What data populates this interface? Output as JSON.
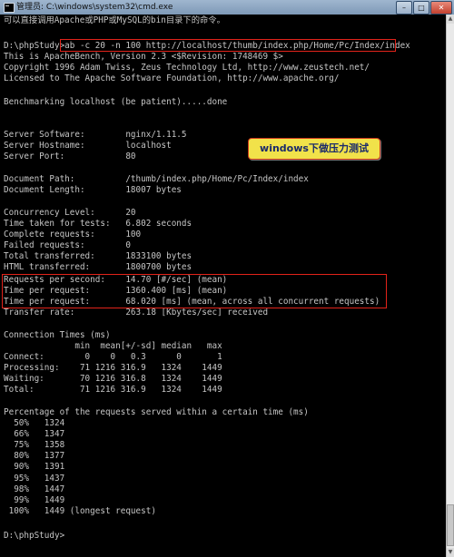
{
  "window": {
    "title": "管理员: C:\\windows\\system32\\cmd.exe",
    "buttons": {
      "minimize": "–",
      "maximize": "□",
      "close": "✕"
    }
  },
  "console": {
    "lines": [
      "可以直接调用Apache或PHP或MySQL的bin目录下的命令。",
      "",
      "D:\\phpStudy>ab -c 20 -n 100 http://localhost/thumb/index.php/Home/Pc/Index/index",
      "This is ApacheBench, Version 2.3 <$Revision: 1748469 $>",
      "Copyright 1996 Adam Twiss, Zeus Technology Ltd, http://www.zeustech.net/",
      "Licensed to The Apache Software Foundation, http://www.apache.org/",
      "",
      "Benchmarking localhost (be patient).....done",
      "",
      "",
      "Server Software:        nginx/1.11.5",
      "Server Hostname:        localhost",
      "Server Port:            80",
      "",
      "Document Path:          /thumb/index.php/Home/Pc/Index/index",
      "Document Length:        18007 bytes",
      "",
      "Concurrency Level:      20",
      "Time taken for tests:   6.802 seconds",
      "Complete requests:      100",
      "Failed requests:        0",
      "Total transferred:      1833100 bytes",
      "HTML transferred:       1800700 bytes",
      "Requests per second:    14.70 [#/sec] (mean)",
      "Time per request:       1360.400 [ms] (mean)",
      "Time per request:       68.020 [ms] (mean, across all concurrent requests)",
      "Transfer rate:          263.18 [Kbytes/sec] received",
      "",
      "Connection Times (ms)",
      "              min  mean[+/-sd] median   max",
      "Connect:        0    0   0.3      0       1",
      "Processing:    71 1216 316.9   1324    1449",
      "Waiting:       70 1216 316.8   1324    1449",
      "Total:         71 1216 316.9   1324    1449",
      "",
      "Percentage of the requests served within a certain time (ms)",
      "  50%   1324",
      "  66%   1347",
      "  75%   1358",
      "  80%   1377",
      "  90%   1391",
      "  95%   1437",
      "  98%   1447",
      "  99%   1449",
      " 100%   1449 (longest request)",
      "",
      "D:\\phpStudy>"
    ]
  },
  "annotation": {
    "callout_text": "windows下做压力测试"
  },
  "colors": {
    "console_bg": "#000000",
    "console_text": "#c6c6c6",
    "highlight": "#e2231a",
    "callout_bg": "#f1e24a",
    "callout_text": "#1a2a6b"
  },
  "icons": {
    "app": "cmd-console-icon"
  }
}
